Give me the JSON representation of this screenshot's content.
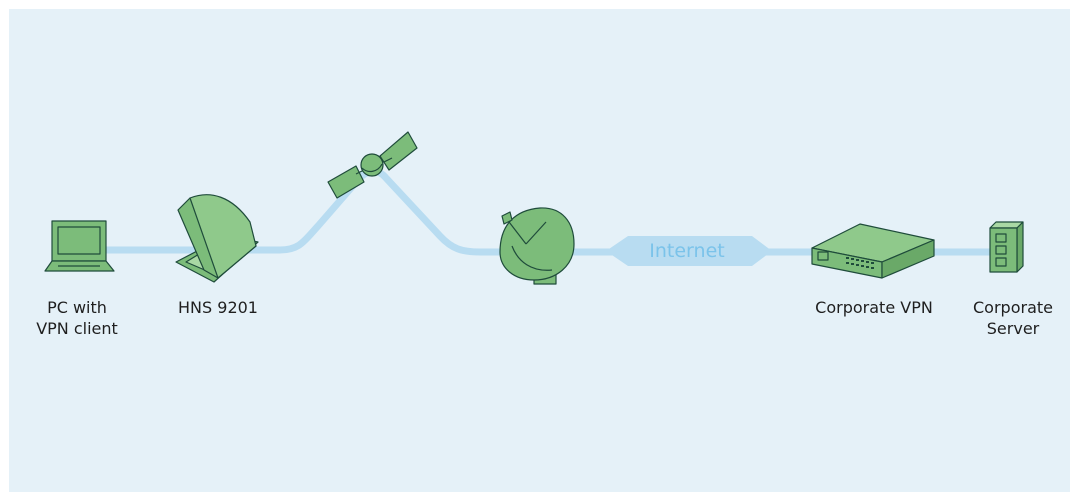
{
  "colors": {
    "background": "#e5f1f8",
    "link": "#b8dcf1",
    "device_fill": "#7cbc7a",
    "device_stroke": "#1f4c3b",
    "internet_text": "#7bc3ea"
  },
  "nodes": {
    "pc": {
      "icon": "laptop-icon",
      "label_line1": "PC with",
      "label_line2": "VPN client"
    },
    "terminal": {
      "icon": "satellite-terminal-icon",
      "label": "HNS 9201"
    },
    "satellite": {
      "icon": "satellite-icon"
    },
    "ground_station": {
      "icon": "satellite-dish-icon"
    },
    "internet": {
      "icon": "internet-cloud-icon",
      "label": "Internet"
    },
    "vpn": {
      "icon": "network-switch-icon",
      "label": "Corporate VPN"
    },
    "server": {
      "icon": "server-icon",
      "label_line1": "Corporate",
      "label_line2": "Server"
    }
  }
}
